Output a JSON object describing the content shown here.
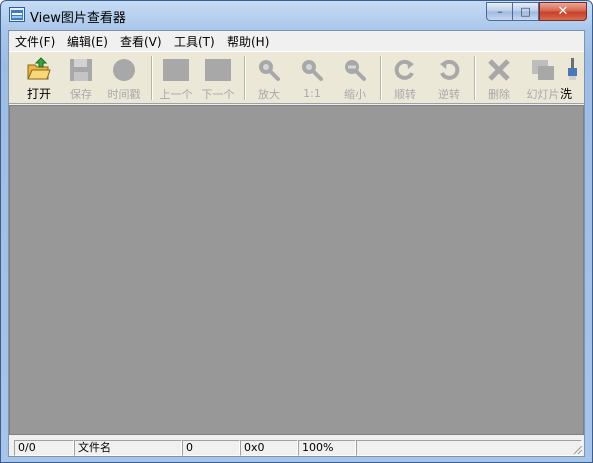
{
  "window": {
    "title": "View图片查看器",
    "minimize_glyph": "–",
    "maximize_glyph": "□",
    "close_glyph": "✕"
  },
  "menu": [
    {
      "label": "文件(F)"
    },
    {
      "label": "编辑(E)"
    },
    {
      "label": "查看(V)"
    },
    {
      "label": "工具(T)"
    },
    {
      "label": "帮助(H)"
    }
  ],
  "toolbar": {
    "open": {
      "label": "打开",
      "icon": "open-folder-icon",
      "enabled": true
    },
    "save": {
      "label": "保存",
      "icon": "floppy-disk-icon",
      "enabled": false
    },
    "timestamp": {
      "label": "时间戳",
      "icon": "circle-stamp-icon",
      "enabled": false
    },
    "prev": {
      "label": "上一个",
      "icon": "previous-image-icon",
      "enabled": false
    },
    "next": {
      "label": "下一个",
      "icon": "next-image-icon",
      "enabled": false
    },
    "zoom_in": {
      "label": "放大",
      "icon": "zoom-in-icon",
      "enabled": false
    },
    "actual": {
      "label": "1:1",
      "icon": "actual-size-icon",
      "enabled": false
    },
    "zoom_out": {
      "label": "缩小",
      "icon": "zoom-out-icon",
      "enabled": false
    },
    "rotate_cw": {
      "label": "顺转",
      "icon": "rotate-clockwise-icon",
      "enabled": false
    },
    "rotate_ccw": {
      "label": "逆转",
      "icon": "rotate-counterclockwise-icon",
      "enabled": false
    },
    "delete": {
      "label": "删除",
      "icon": "delete-x-icon",
      "enabled": false
    },
    "slideshow": {
      "label": "幻灯片",
      "icon": "slideshow-icon",
      "enabled": false
    },
    "wash": {
      "label": "洗",
      "icon": "brush-icon",
      "enabled": true
    }
  },
  "status": {
    "index": "0/0",
    "filename": "文件名",
    "size": "0",
    "dimensions": "0x0",
    "zoom": "100%"
  },
  "colors": {
    "viewer_bg": "#989898",
    "toolbar_bg": "#ebe8d8",
    "disabled_icon": "#a8a8a8"
  }
}
